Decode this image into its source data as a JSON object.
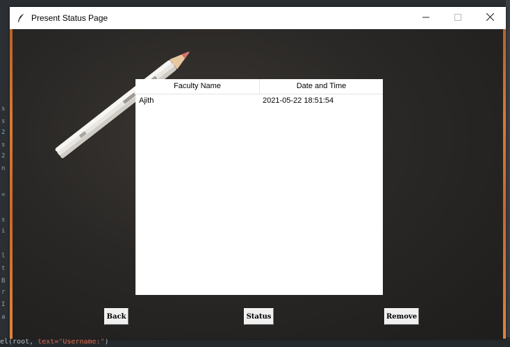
{
  "window": {
    "title": "Present Status Page",
    "app_icon": "feather-icon",
    "controls": [
      "minimize-icon",
      "maximize-icon",
      "close-icon"
    ]
  },
  "table": {
    "columns": [
      "Faculty Name",
      "Date and Time"
    ],
    "rows": [
      [
        "Ajith",
        "2021-05-22 18:51:54"
      ]
    ]
  },
  "buttons": {
    "back": "Back",
    "status": "Status",
    "remove": "Remove"
  },
  "background_editor": {
    "bottom_line_prefix": "el(root, ",
    "bottom_line_kw": "text=",
    "bottom_line_str": "\"Username:\"",
    "bottom_line_suffix": ")",
    "gutter_chars": [
      "s",
      "s",
      "2",
      "s",
      "2",
      "n",
      "=",
      "s",
      "i",
      "l",
      "t",
      "B",
      "r",
      "I",
      "a"
    ]
  }
}
